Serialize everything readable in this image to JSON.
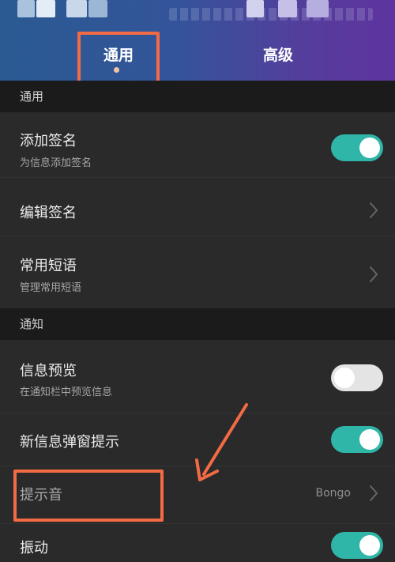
{
  "tabs": [
    {
      "label": "通用",
      "active": true
    },
    {
      "label": "高级",
      "active": false
    }
  ],
  "sections": [
    {
      "title": "通用"
    },
    {
      "title": "通知"
    }
  ],
  "rows": {
    "add_signature": {
      "title": "添加签名",
      "subtitle": "为信息添加签名",
      "toggle": true
    },
    "edit_signature": {
      "title": "编辑签名"
    },
    "common_phrases": {
      "title": "常用短语",
      "subtitle": "管理常用短语"
    },
    "message_preview": {
      "title": "信息预览",
      "subtitle": "在通知栏中预览信息",
      "toggle": false
    },
    "popup_notification": {
      "title": "新信息弹窗提示",
      "toggle": true
    },
    "notification_sound": {
      "title": "提示音",
      "value": "Bongo"
    },
    "vibration": {
      "title": "振动",
      "toggle": true
    }
  },
  "colors": {
    "accent_toggle_on": "#2fb6a9",
    "annotation": "#f26b45",
    "header_left": "#2a5a92",
    "header_right": "#5e349e"
  },
  "icons": [
    "chevron-right-icon"
  ]
}
